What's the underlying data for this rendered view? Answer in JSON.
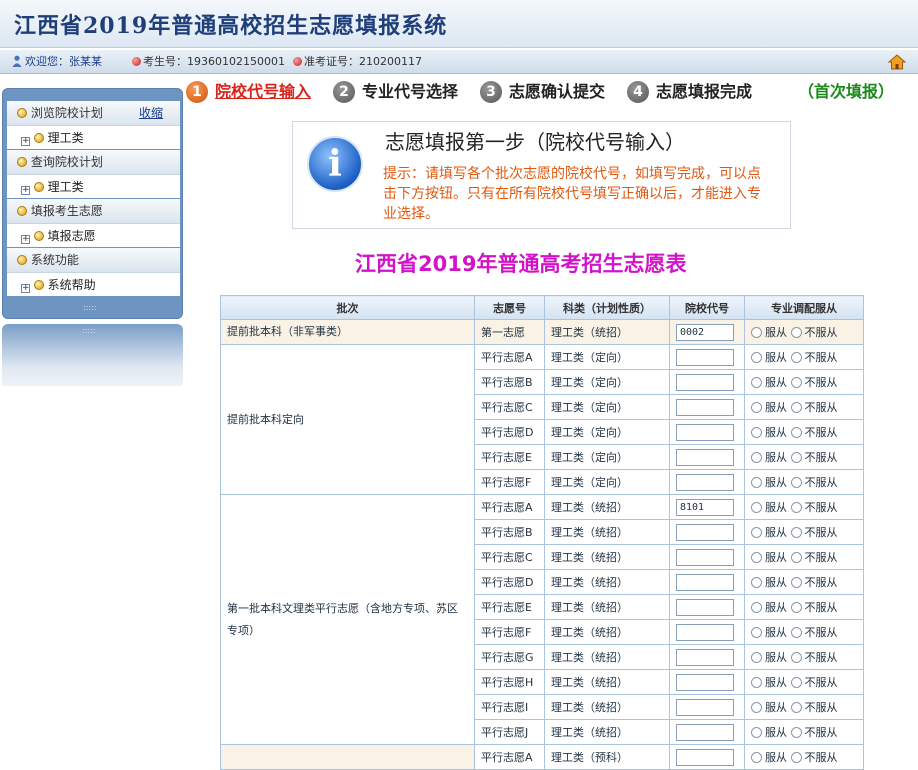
{
  "app": {
    "title": "江西省2019年普通高校招生志愿填报系统"
  },
  "userbar": {
    "welcome_label": "欢迎您：",
    "user_name": "张某某",
    "exam_no_label": "考生号：",
    "exam_no": "19360102150001",
    "admit_no_label": "准考证号：",
    "admit_no": "210200117",
    "home_icon": "home-icon"
  },
  "sidebar": {
    "collapse_label": "收缩",
    "sections": [
      {
        "title": "浏览院校计划",
        "item": "理工类"
      },
      {
        "title": "查询院校计划",
        "item": "理工类"
      },
      {
        "title": "填报考生志愿",
        "item": "填报志愿"
      },
      {
        "title": "系统功能",
        "item": "系统帮助"
      }
    ]
  },
  "steps": [
    {
      "num": "1",
      "label": "院校代号输入"
    },
    {
      "num": "2",
      "label": "专业代号选择"
    },
    {
      "num": "3",
      "label": "志愿确认提交"
    },
    {
      "num": "4",
      "label": "志愿填报完成"
    }
  ],
  "fill_status": "（首次填报）",
  "step_box": {
    "title": "志愿填报第一步（院校代号输入）",
    "hint": "提示：请填写各个批次志愿的院校代号，如填写完成，可以点击下方按钮。只有在所有院校代号填写正确以后，才能进入专业选择。"
  },
  "form_title": "江西省2019年普通高考招生志愿表",
  "table": {
    "headers": [
      "批次",
      "志愿号",
      "科类（计划性质）",
      "院校代号",
      "专业调配服从"
    ],
    "radio_yes": "服从",
    "radio_no": "不服从",
    "groups": [
      {
        "batch": "提前批本科（非军事类）",
        "rows": [
          {
            "choice": "第一志愿",
            "category": "理工类（统招）",
            "code": "0002"
          }
        ]
      },
      {
        "batch": "提前批本科定向",
        "rows": [
          {
            "choice": "平行志愿A",
            "category": "理工类（定向）",
            "code": ""
          },
          {
            "choice": "平行志愿B",
            "category": "理工类（定向）",
            "code": ""
          },
          {
            "choice": "平行志愿C",
            "category": "理工类（定向）",
            "code": ""
          },
          {
            "choice": "平行志愿D",
            "category": "理工类（定向）",
            "code": ""
          },
          {
            "choice": "平行志愿E",
            "category": "理工类（定向）",
            "code": ""
          },
          {
            "choice": "平行志愿F",
            "category": "理工类（定向）",
            "code": ""
          }
        ]
      },
      {
        "batch": "第一批本科文理类平行志愿（含地方专项、苏区专项）",
        "rows": [
          {
            "choice": "平行志愿A",
            "category": "理工类（统招）",
            "code": "8101"
          },
          {
            "choice": "平行志愿B",
            "category": "理工类（统招）",
            "code": ""
          },
          {
            "choice": "平行志愿C",
            "category": "理工类（统招）",
            "code": ""
          },
          {
            "choice": "平行志愿D",
            "category": "理工类（统招）",
            "code": ""
          },
          {
            "choice": "平行志愿E",
            "category": "理工类（统招）",
            "code": ""
          },
          {
            "choice": "平行志愿F",
            "category": "理工类（统招）",
            "code": ""
          },
          {
            "choice": "平行志愿G",
            "category": "理工类（统招）",
            "code": ""
          },
          {
            "choice": "平行志愿H",
            "category": "理工类（统招）",
            "code": ""
          },
          {
            "choice": "平行志愿I",
            "category": "理工类（统招）",
            "code": ""
          },
          {
            "choice": "平行志愿J",
            "category": "理工类（统招）",
            "code": ""
          }
        ]
      },
      {
        "batch": "",
        "rows": [
          {
            "choice": "平行志愿A",
            "category": "理工类（预科）",
            "code": ""
          }
        ]
      }
    ]
  },
  "colors": {
    "accent": "#d114c7",
    "hint": "#e0580e",
    "active_step": "#d8241a",
    "status": "#1a8a1a",
    "panel": "#6e95c2"
  }
}
